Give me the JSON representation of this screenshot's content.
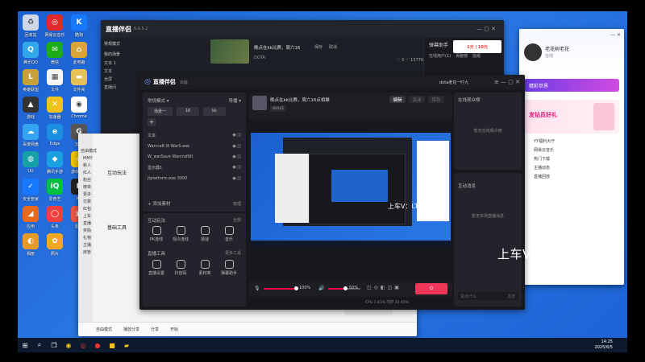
{
  "desktop_icons": [
    {
      "label": "回收站",
      "color": "#cfd8e8",
      "glyph": "♻"
    },
    {
      "label": "网易云音乐",
      "color": "#e02b2b",
      "glyph": "◎"
    },
    {
      "label": "酷狗",
      "color": "#1677ff",
      "glyph": "K"
    },
    {
      "label": "腾讯QQ",
      "color": "#2fa7e8",
      "glyph": "Q"
    },
    {
      "label": "微信",
      "color": "#1aad19",
      "glyph": "✉"
    },
    {
      "label": "此电脑",
      "color": "#d9a53a",
      "glyph": "⌂"
    },
    {
      "label": "英雄联盟",
      "color": "#c9a13b",
      "glyph": "L"
    },
    {
      "label": "文件",
      "color": "#f4f4f4",
      "glyph": "▦"
    },
    {
      "label": "文件夹",
      "color": "#e5c158",
      "glyph": "▬"
    },
    {
      "label": "游戏",
      "color": "#333",
      "glyph": "▲"
    },
    {
      "label": "加速器",
      "color": "#f0c31c",
      "glyph": "✕"
    },
    {
      "label": "Chrome",
      "color": "#ffffff",
      "glyph": "◉"
    },
    {
      "label": "百度网盘",
      "color": "#35a4f2",
      "glyph": "☁"
    },
    {
      "label": "Edge",
      "color": "#1c8ee3",
      "glyph": "e"
    },
    {
      "label": "加速",
      "color": "#555",
      "glyph": "G"
    },
    {
      "label": "UU",
      "color": "#16a0a8",
      "glyph": "◍"
    },
    {
      "label": "腾讯手游",
      "color": "#1aa0e0",
      "glyph": "◆"
    },
    {
      "label": "游戏助手",
      "color": "#f0c300",
      "glyph": "◈"
    },
    {
      "label": "安全管家",
      "color": "#1677ff",
      "glyph": "✓"
    },
    {
      "label": "爱奇艺",
      "color": "#00c040",
      "glyph": "iQ"
    },
    {
      "label": "Kk",
      "color": "#222",
      "glyph": "K"
    },
    {
      "label": "应用",
      "color": "#e86a1e",
      "glyph": "◢"
    },
    {
      "label": "头条",
      "color": "#f04040",
      "glyph": "◯"
    },
    {
      "label": "图片",
      "color": "#e54",
      "glyph": "▣"
    },
    {
      "label": "相册",
      "color": "#e59a2a",
      "glyph": "◐"
    },
    {
      "label": "照片",
      "color": "#f5a623",
      "glyph": "✿"
    }
  ],
  "back_window": {
    "title": "直播伴侣",
    "version": "6.6.5.2",
    "stream_title": "晚点在kk比赛，周六16",
    "game": "DOTA",
    "tab_a": "保存",
    "tab_b": "取消",
    "mode": "常规模式",
    "my_scene": "我的场景",
    "side_items": [
      "文本 1",
      "文本",
      "全屏",
      "直播间"
    ],
    "helper": "弹幕助手",
    "helper_tabs": [
      "在线用户(1)",
      "贡献榜",
      "贴纸"
    ],
    "likes": "0",
    "fans": "13776"
  },
  "chat_window": {
    "mode": "自由模式",
    "rows": [
      "MMY",
      "新人",
      "红人",
      "粉丝",
      "榜单",
      "更多",
      "付费",
      "红包",
      "上车",
      "直播",
      "奖励",
      "礼物",
      "主播",
      "房管"
    ],
    "section": "互动玩法",
    "section2": "基础工具",
    "bottom_items": [
      "自由模式",
      "播放分享",
      "分享",
      "开始"
    ]
  },
  "qq_window": {
    "name": "老花树老花",
    "status": "在线",
    "banner": "精彩世界",
    "promo": "发钻员好礼",
    "links": [
      "YY福利大厅",
      "网易云音乐",
      "热门下载",
      "主播动态",
      "直播回放"
    ]
  },
  "main_window": {
    "title": "直播伴侣",
    "subtitle": "出版",
    "mode": "常规模式",
    "stream_btn": "导播",
    "scene_tabs": [
      "场景一",
      "16",
      "kk"
    ],
    "add": "+",
    "sources": [
      {
        "label": "文本",
        "detail": ""
      },
      {
        "label": "Warcraft III WarS.exe",
        "detail": ""
      },
      {
        "label": "W_warSave WarcraftIII",
        "detail": ""
      },
      {
        "label": "显示器1",
        "detail": ""
      },
      {
        "label": "jtplatform.exe 3000",
        "detail": ""
      }
    ],
    "add_material": "添加素材",
    "manage": "管理",
    "interaction": "互动玩法",
    "more": "全部",
    "interaction_tools": [
      "PK连线",
      "观众连线",
      "猜谜",
      "音乐"
    ],
    "live_tools_title": "直播工具",
    "live_tools_more": "更多工具",
    "live_tools": [
      "直播设置",
      "抖音码",
      "素材库",
      "弹幕助手"
    ],
    "live_title": "晚点在kk比赛，周六16点相聚",
    "room": "dota1",
    "btn_cancel": "编辑",
    "btn_hide": "关闭",
    "btn_save": "保存",
    "online_title": "在线观众榜",
    "online_empty": "暂无在线观众榜",
    "msg_title": "互动消息",
    "msg_empty": "暂无本场直播消息",
    "mic_level": "100%",
    "speaker_level": "50%",
    "cpu": "CPU 1.41%",
    "mem": "内存 25.45%",
    "fps": "帧率 60",
    "start_btn": "开始直播",
    "user": "dota老花一叮九",
    "chat_placeholder": "说点什么",
    "send": "发送"
  },
  "watermark": "上车V：LTX113236",
  "watermark_small": "上车V：LTX113236",
  "clock": {
    "time": "14:25",
    "date": "2025/6/5"
  },
  "taskbar_icons": [
    "windows-start",
    "search",
    "task-view",
    "chrome",
    "netease",
    "recorder",
    "app",
    "folder"
  ]
}
